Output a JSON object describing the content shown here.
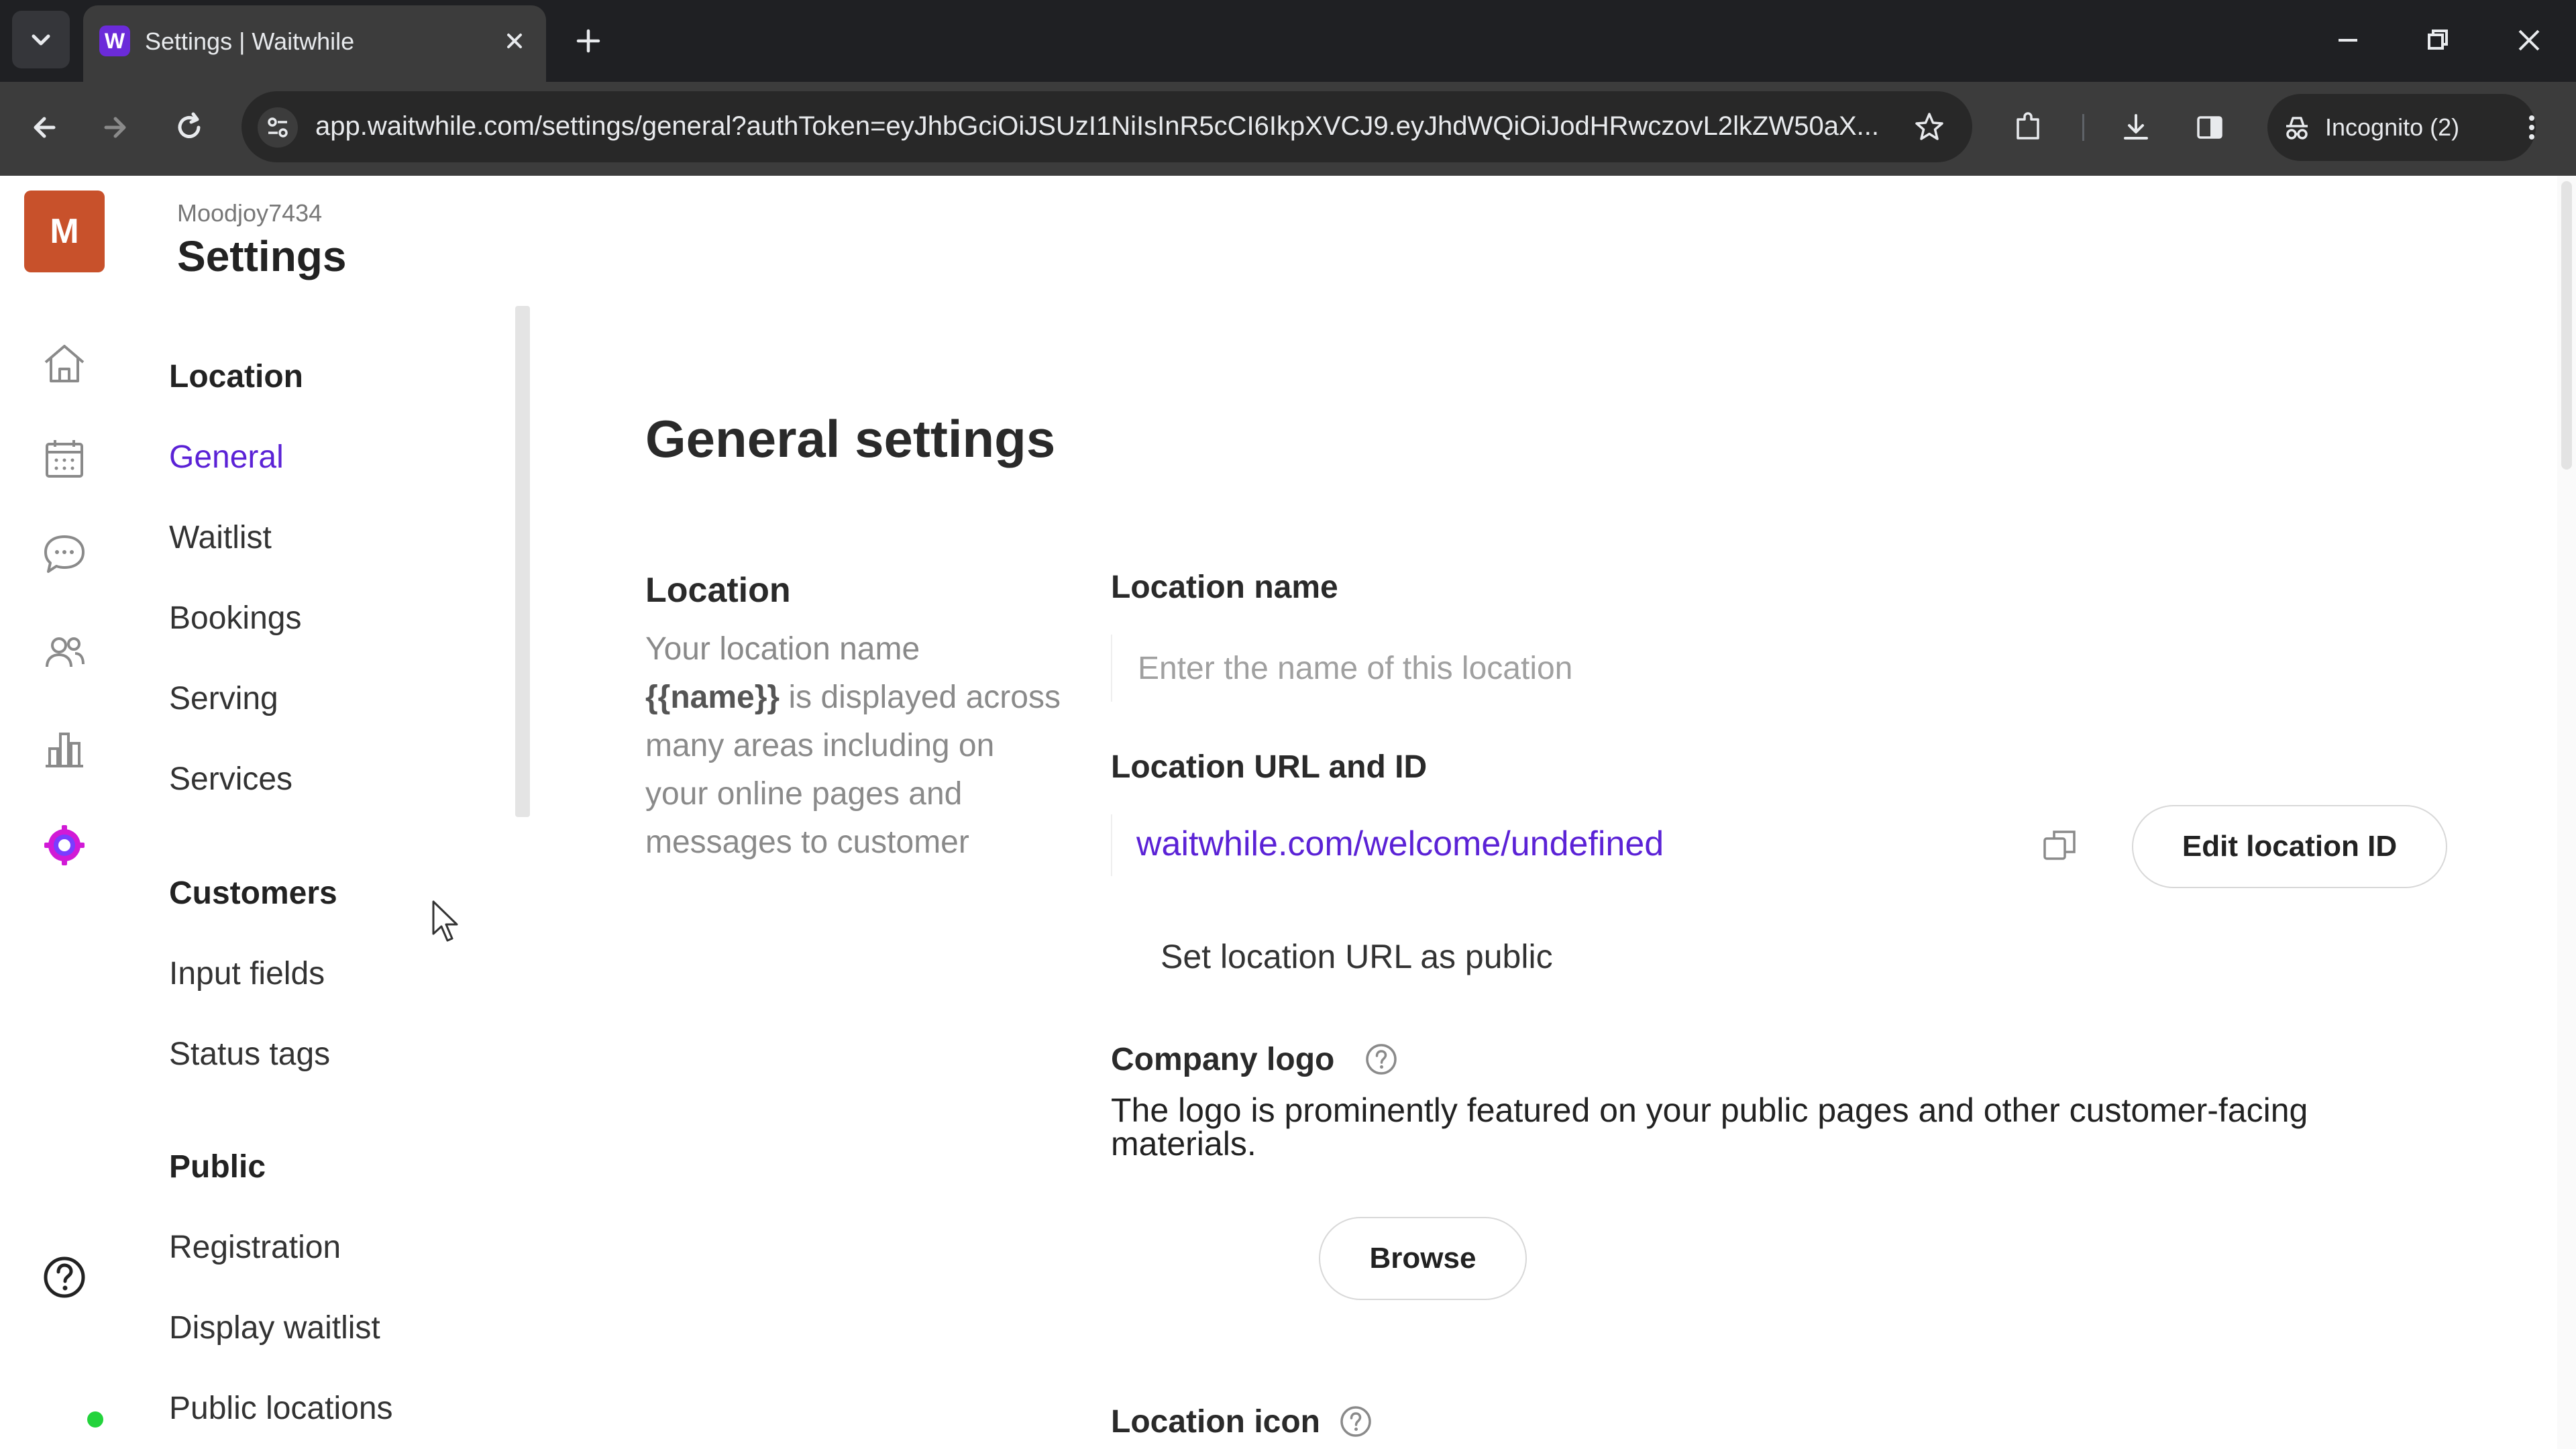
{
  "browser": {
    "tab_title": "Settings | Waitwhile",
    "favicon_letter": "W",
    "url": "app.waitwhile.com/settings/general?authToken=eyJhbGciOiJSUzI1NiIsInR5cCI6IkpXVCJ9.eyJhdWQiOiJodHRwczovL2lkZW50aX...",
    "incognito_label": "Incognito (2)"
  },
  "app": {
    "avatar_letter": "M",
    "rail_icons": [
      "home-icon",
      "calendar-icon",
      "chat-icon",
      "users-icon",
      "analytics-icon",
      "settings-gear-icon",
      "help-icon"
    ],
    "accent_color": "#5b22d6"
  },
  "header": {
    "org_name": "Moodjoy7434",
    "title": "Settings"
  },
  "nav": {
    "location_heading": "Location",
    "location_items": [
      "General",
      "Waitlist",
      "Bookings",
      "Serving",
      "Services"
    ],
    "customers_heading": "Customers",
    "customers_items": [
      "Input fields",
      "Status tags"
    ],
    "public_heading": "Public",
    "public_items": [
      "Registration",
      "Display waitlist",
      "Public locations"
    ],
    "active_item": "General"
  },
  "main": {
    "title": "General settings",
    "section_title": "Location",
    "section_desc_pre": "Your location name ",
    "section_desc_var": "{{name}}",
    "section_desc_post": " is displayed across many areas including on your online pages and messages to customer",
    "location_name_label": "Location name",
    "location_name_placeholder": "Enter the name of this location",
    "location_name_value": "",
    "url_label": "Location URL and ID",
    "url_value": "waitwhile.com/welcome/undefined",
    "edit_id_button": "Edit location ID",
    "public_toggle_label": "Set location URL as public",
    "logo_label": "Company logo",
    "logo_desc": "The logo is prominently featured on your public pages and other customer-facing materials.",
    "browse_button": "Browse",
    "icon_label": "Location icon"
  }
}
